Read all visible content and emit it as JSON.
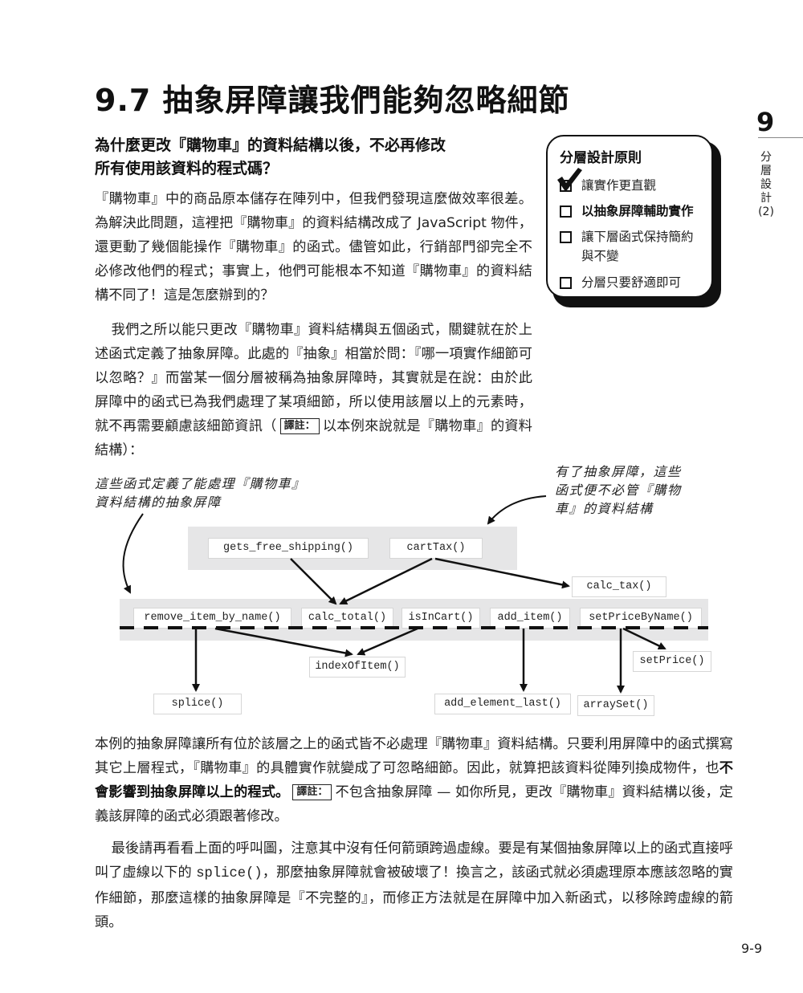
{
  "heading": {
    "title": "9.7  抽象屏障讓我們能夠忽略細節",
    "question_line1": "為什麼更改『購物車』的資料結構以後，不必再修改",
    "question_line2": "所有使用該資料的程式碼？"
  },
  "side_tab": {
    "chapter_number": "9",
    "chapter_label": "分層設計(2)"
  },
  "principles_box": {
    "title": "分層設計原則",
    "items": [
      {
        "label": "讓實作更直觀",
        "checked": true,
        "emphasized": false
      },
      {
        "label": "以抽象屏障輔助實作",
        "checked": false,
        "emphasized": true
      },
      {
        "label": "讓下層函式保持簡約與不變",
        "checked": false,
        "emphasized": false
      },
      {
        "label": "分層只要舒適即可",
        "checked": false,
        "emphasized": false
      }
    ]
  },
  "body": {
    "p1": "『購物車』中的商品原本儲存在陣列中，但我們發現這麼做效率很差。為解決此問題，這裡把『購物車』的資料結構改成了 JavaScript 物件，還更動了幾個能操作『購物車』的函式。儘管如此，行銷部門卻完全不必修改他們的程式；事實上，他們可能根本不知道『購物車』的資料結構不同了！這是怎麼辦到的？",
    "p2_before_note": "我們之所以能只更改『購物車』資料結構與五個函式，關鍵就在於上述函式定義了抽象屏障。此處的『抽象』相當於問：『哪一項實作細節可以忽略？』而當某一個分層被稱為抽象屏障時，其實就是在說：由於此屏障中的函式已為我們處理了某項細節，所以使用該層以上的元素時，就不再需要顧慮該細節資訊（",
    "p2_note_tag": "譯註：",
    "p2_after_note": "以本例來說就是『購物車』的資料結構）：",
    "p3_before_bold": "本例的抽象屏障讓所有位於該層之上的函式皆不必處理『購物車』資料結構。只要利用屏障中的函式撰寫其它上層程式，『購物車』的具體實作就變成了可忽略細節。因此，就算把該資料從陣列換成物件，也",
    "p3_bold": "不會影響到抽象屏障以上的程式。",
    "p3_note_tag": "譯註：",
    "p3_after_note": "不包含抽象屏障 — 如你所見，更改『購物車』資料結構以後，定義該屏障的函式必須跟著修改。",
    "p4_before_code": "最後請再看看上面的呼叫圖，注意其中沒有任何箭頭跨過虛線。要是有某個抽象屏障以上的函式直接呼叫了虛線以下的 ",
    "p4_code": "splice()",
    "p4_after_code": "，那麼抽象屏障就會被破壞了！換言之，該函式就必須處理原本應該忽略的實作細節，那麼這樣的抽象屏障是『不完整的』，而修正方法就是在屏障中加入新函式，以移除跨虛線的箭頭。"
  },
  "diagram": {
    "annotation_left": "這些函式定義了能處理『購物車』資料結構的抽象屏障",
    "annotation_left_line1": "這些函式定義了能處理『購物車』",
    "annotation_left_line2": "資料結構的抽象屏障",
    "annotation_right_line1": "有了抽象屏障，這些",
    "annotation_right_line2": "函式便不必管『購物",
    "annotation_right_line3": "車』的資料結構",
    "top_layer": [
      "gets_free_shipping()",
      "cartTax()"
    ],
    "barrier_layer": [
      "remove_item_by_name()",
      "calc_total()",
      "isInCart()",
      "add_item()",
      "setPriceByName()"
    ],
    "side_nodes": [
      "calc_tax()",
      "indexOfItem()",
      "setPrice()"
    ],
    "bottom_layer": [
      "splice()",
      "add_element_last()",
      "arraySet()"
    ],
    "calls": [
      {
        "from": "gets_free_shipping()",
        "to": "calc_total()"
      },
      {
        "from": "cartTax()",
        "to": "calc_total()"
      },
      {
        "from": "cartTax()",
        "to": "calc_tax()"
      },
      {
        "from": "remove_item_by_name()",
        "to": "splice()"
      },
      {
        "from": "remove_item_by_name()",
        "to": "indexOfItem()"
      },
      {
        "from": "isInCart()",
        "to": "indexOfItem()"
      },
      {
        "from": "add_item()",
        "to": "add_element_last()"
      },
      {
        "from": "setPriceByName()",
        "to": "arraySet()"
      },
      {
        "from": "setPriceByName()",
        "to": "setPrice()"
      }
    ]
  },
  "footer": {
    "page_number": "9-9"
  }
}
